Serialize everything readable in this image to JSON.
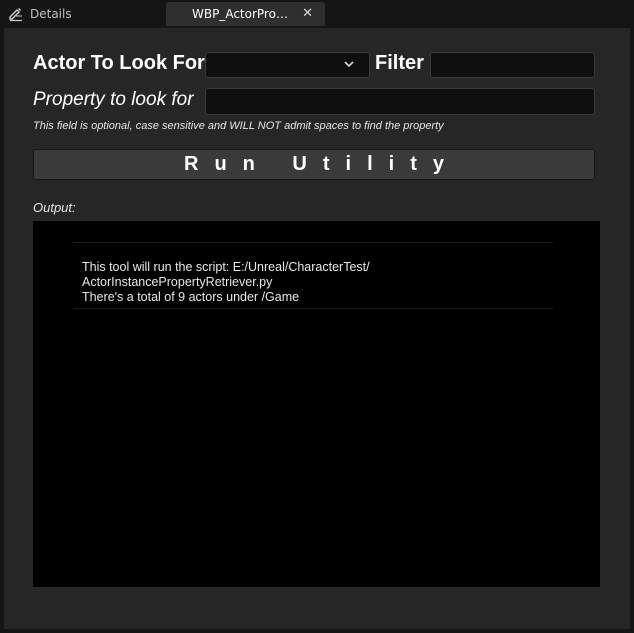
{
  "tabs": {
    "details_label": "Details",
    "active_label": "WBP_ActorProp...",
    "close_glyph": "✕"
  },
  "form": {
    "actor_label": "Actor To Look For",
    "actor_selected": "",
    "filter_label": "Filter",
    "filter_value": "",
    "property_label": "Property to look for",
    "property_value": "",
    "hint": "This field is optional, case sensitive and WILL NOT admit spaces to find the property"
  },
  "run_button_label": "Run Utility",
  "output": {
    "label": "Output:",
    "lines": [
      "This tool will run the script: E:/Unreal/CharacterTest/",
      "ActorInstancePropertyRetriever.py",
      "There's a total of 9 actors under /Game"
    ]
  },
  "icons": {
    "details": "edit-pencil-icon",
    "dropdown": "chevron-down-icon",
    "close": "close-icon"
  },
  "colors": {
    "background": "#151515",
    "panel": "#262626",
    "field": "#0f0f0f",
    "button": "#3a3a3a",
    "output_bg": "#000000"
  }
}
